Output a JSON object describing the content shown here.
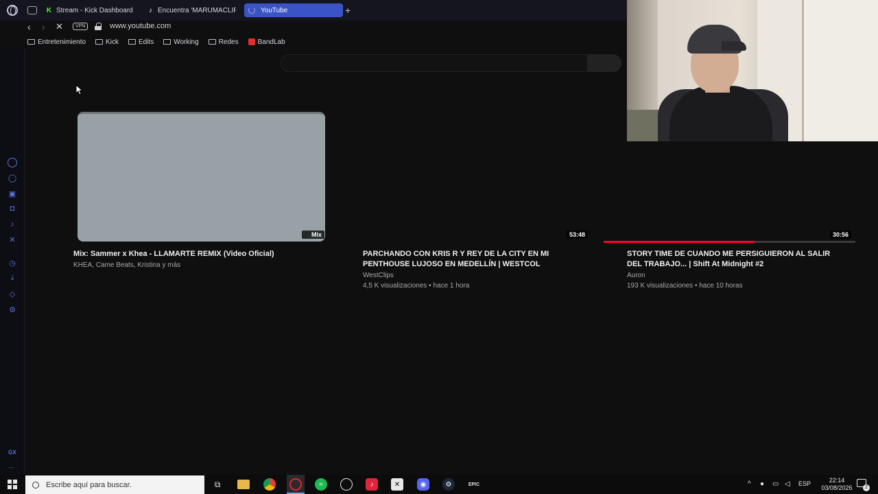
{
  "browser": {
    "tabs": [
      {
        "label": "Stream - Kick Dashboard",
        "icon": "kick-icon"
      },
      {
        "label": "Encuentra 'MARUMACLIPS",
        "icon": "tiktok-icon"
      },
      {
        "label": "YouTube",
        "icon": "loading-spinner-icon",
        "active": true
      }
    ],
    "new_tab_label": "+",
    "vpn_label": "VPN",
    "url": "www.youtube.com",
    "bookmarks": [
      {
        "label": "Entretenimiento"
      },
      {
        "label": "Kick"
      },
      {
        "label": "Edits"
      },
      {
        "label": "Working"
      },
      {
        "label": "Redes"
      },
      {
        "label": "BandLab"
      }
    ],
    "accent_color": "#3a54c8"
  },
  "sidebar": {
    "items": [
      "aria-icon",
      "whatsapp-icon",
      "discord-icon",
      "instagram-icon",
      "tiktok-icon",
      "x-icon",
      "history-icon",
      "downloads-icon",
      "extensions-icon",
      "settings-icon"
    ],
    "footer_label": "GX",
    "more_label": "..."
  },
  "youtube": {
    "videos": [
      {
        "title": "Mix: Sammer x Khea - LLAMARTE REMIX (Video Oficial)",
        "title_line2": "",
        "channel": "KHEA, Came Beats, Kristina y más",
        "meta": "",
        "badge": "Mix"
      },
      {
        "title": "PARCHANDO CON KRIS R Y REY DE LA CITY EN MI",
        "title_line2": "PENTHOUSE LUJOSO EN MEDELLÍN | WESTCOL",
        "channel": "WestClips",
        "meta": "4,5 K visualizaciones • hace 1 hora",
        "badge": "53:48"
      },
      {
        "title": "STORY TIME DE CUANDO ME PERSIGUIERON AL SALIR",
        "title_line2": "DEL TRABAJO... | Shift At Midnight #2",
        "channel": "Auron",
        "meta": "193 K visualizaciones • hace 10 horas",
        "badge": "30:56",
        "watched_fraction": 0.6
      }
    ],
    "progress_color": "#ff0033"
  },
  "taskbar": {
    "search_placeholder": "Escribe aquí para buscar.",
    "language": "ESP",
    "time": "22:14",
    "date": "03/08/2026",
    "notification_count": "2"
  }
}
